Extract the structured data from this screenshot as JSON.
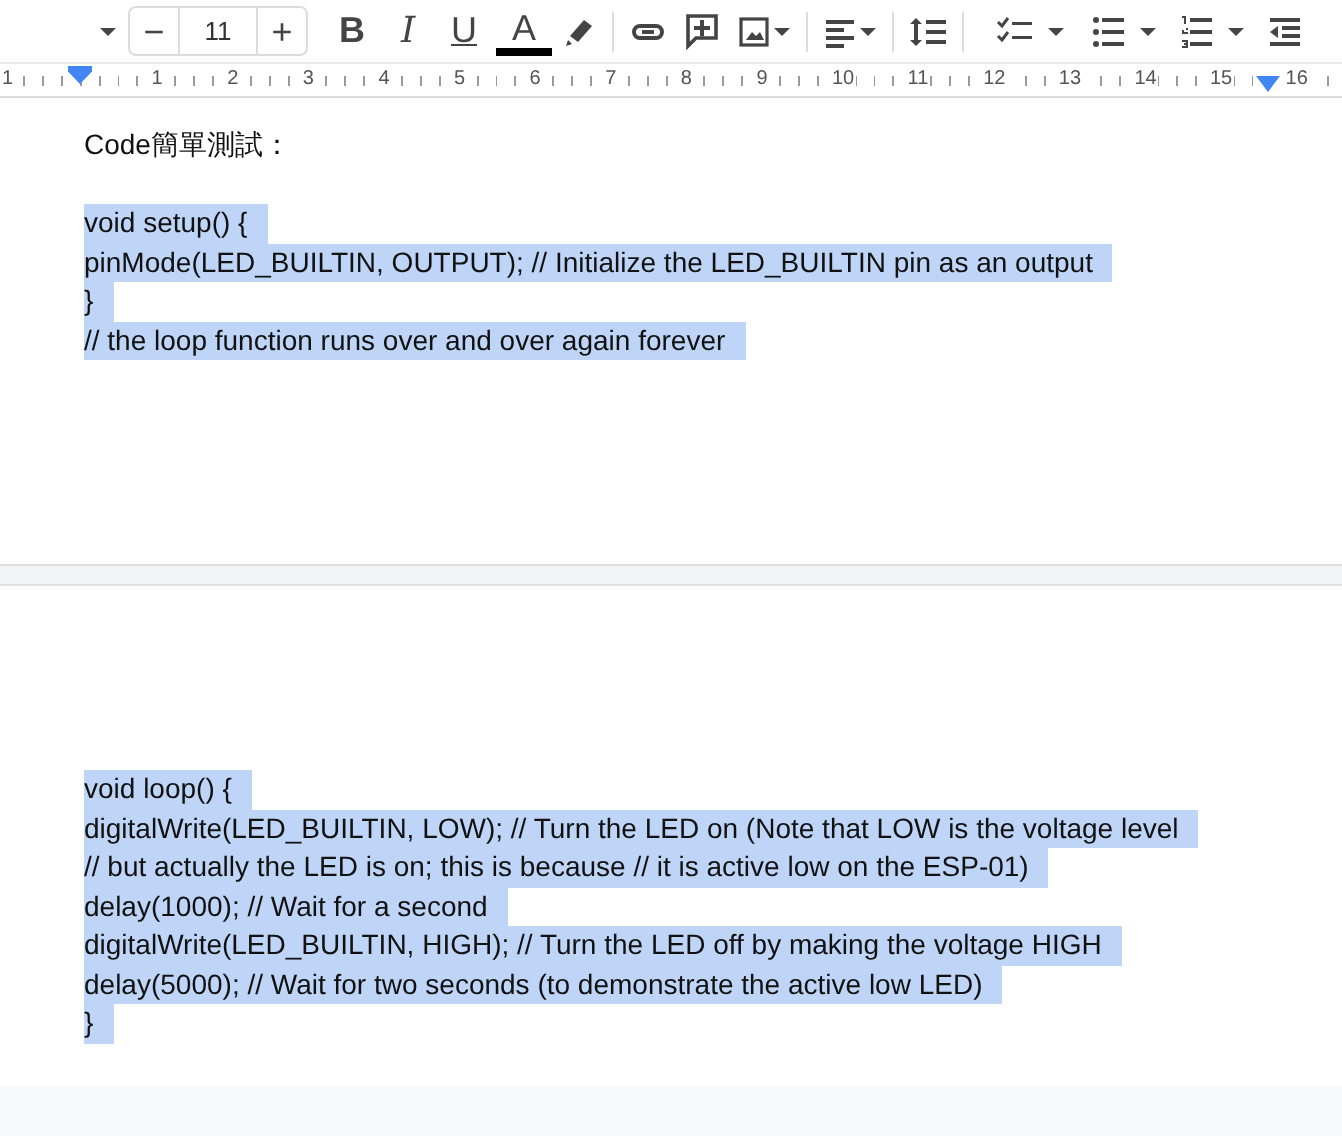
{
  "toolbar": {
    "font_size": "11",
    "minus": "−",
    "plus": "+",
    "bold": "B",
    "italic": "I",
    "underline": "U",
    "text_color": "A"
  },
  "ruler": {
    "numbers": [
      "1",
      "1",
      "2",
      "3",
      "4",
      "5",
      "6",
      "7",
      "8",
      "9",
      "10",
      "11",
      "12",
      "13",
      "14",
      "15",
      "16"
    ]
  },
  "pages": [
    {
      "lines": [
        {
          "text": "Code簡單測試：",
          "selected": false,
          "gap_before": false
        },
        {
          "text": "void setup() {",
          "selected": true,
          "gap_before": true
        },
        {
          "text": "pinMode(LED_BUILTIN, OUTPUT); // Initialize the LED_BUILTIN pin as an output",
          "selected": true,
          "gap_before": false
        },
        {
          "text": "}",
          "selected": true,
          "gap_before": false
        },
        {
          "text": "// the loop function runs over and over again forever",
          "selected": true,
          "gap_before": false
        }
      ]
    },
    {
      "lines": [
        {
          "text": "void loop() {",
          "selected": true,
          "gap_before": false
        },
        {
          "text": "digitalWrite(LED_BUILTIN, LOW); // Turn the LED on (Note that LOW is the voltage level",
          "selected": true,
          "gap_before": false
        },
        {
          "text": "// but actually the LED is on; this is because // it is active low on the ESP-01)",
          "selected": true,
          "gap_before": false
        },
        {
          "text": "delay(1000); // Wait for a second",
          "selected": true,
          "gap_before": false
        },
        {
          "text": "digitalWrite(LED_BUILTIN, HIGH); // Turn the LED off by making the voltage HIGH",
          "selected": true,
          "gap_before": false
        },
        {
          "text": "delay(5000); // Wait for two seconds (to demonstrate the active low LED)",
          "selected": true,
          "gap_before": false
        },
        {
          "text": "}",
          "selected": true,
          "gap_before": false
        }
      ]
    }
  ]
}
